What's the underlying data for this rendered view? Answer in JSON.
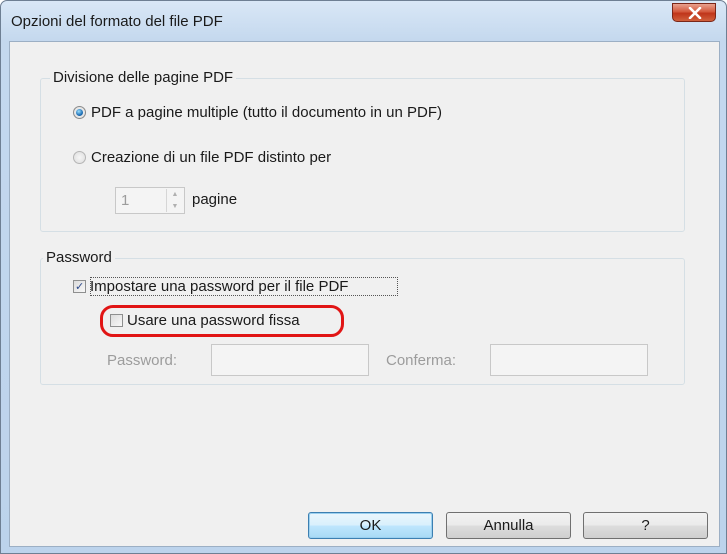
{
  "window": {
    "title": "Opzioni del formato del file PDF",
    "close_icon": "close-icon"
  },
  "page_division": {
    "legend": "Divisione delle pagine PDF",
    "option_multi": {
      "label": "PDF a pagine multiple (tutto il documento in un PDF)",
      "selected": true
    },
    "option_split": {
      "label": "Creazione di un file PDF distinto per",
      "selected": false
    },
    "pages_value": "1",
    "pages_label": "pagine"
  },
  "password": {
    "legend": "Password",
    "set_password": {
      "label": "Impostare una password per il file PDF",
      "checked": true
    },
    "fixed_password": {
      "label": "Usare una password fissa",
      "checked": false
    },
    "password_label": "Password:",
    "confirm_label": "Conferma:",
    "password_value": "",
    "confirm_value": ""
  },
  "buttons": {
    "ok": "OK",
    "cancel": "Annulla",
    "help": "?"
  },
  "colors": {
    "highlight": "#e11515",
    "default_button_border": "#3c7fb1"
  }
}
